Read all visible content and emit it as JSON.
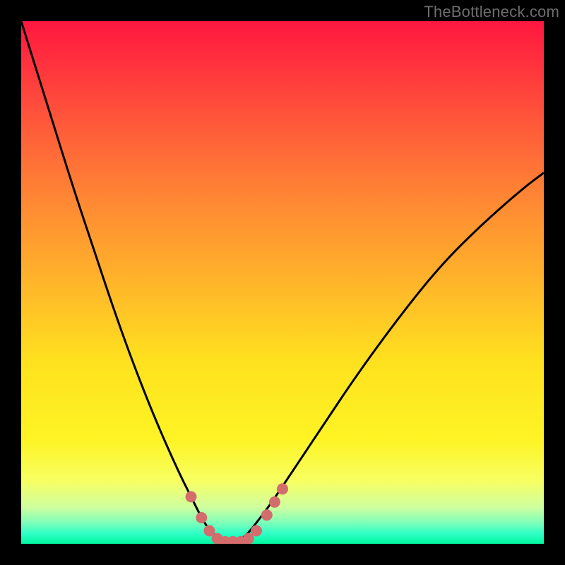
{
  "watermark": "TheBottleneck.com",
  "chart_data": {
    "type": "line",
    "title": "",
    "xlabel": "",
    "ylabel": "",
    "xlim": [
      0,
      100
    ],
    "ylim": [
      0,
      100
    ],
    "series": [
      {
        "name": "bottleneck-curve",
        "x": [
          0,
          5,
          10,
          14,
          18,
          22,
          26,
          30,
          33,
          35,
          37,
          39,
          41,
          43,
          45,
          48,
          52,
          58,
          64,
          72,
          80,
          88,
          96,
          100
        ],
        "y": [
          100,
          84,
          68,
          56,
          44,
          33,
          23,
          14,
          8,
          4,
          1.5,
          0.4,
          0.4,
          1.5,
          4,
          8,
          14,
          23,
          32,
          43,
          53,
          61,
          68,
          71
        ]
      }
    ],
    "markers": {
      "name": "highlight-dots",
      "color": "#d36d6d",
      "points": [
        {
          "x": 32.5,
          "y": 9.0
        },
        {
          "x": 34.5,
          "y": 5.0
        },
        {
          "x": 36.0,
          "y": 2.5
        },
        {
          "x": 37.5,
          "y": 1.0
        },
        {
          "x": 39.0,
          "y": 0.4
        },
        {
          "x": 40.5,
          "y": 0.4
        },
        {
          "x": 42.0,
          "y": 0.4
        },
        {
          "x": 43.5,
          "y": 1.0
        },
        {
          "x": 45.0,
          "y": 2.5
        },
        {
          "x": 47.0,
          "y": 5.5
        },
        {
          "x": 48.5,
          "y": 8.0
        },
        {
          "x": 50.0,
          "y": 10.5
        }
      ]
    },
    "gradient_stops": [
      {
        "pos": 0,
        "color": "#ff163f"
      },
      {
        "pos": 20,
        "color": "#ff5a3a"
      },
      {
        "pos": 50,
        "color": "#ffb52a"
      },
      {
        "pos": 80,
        "color": "#fef424"
      },
      {
        "pos": 96,
        "color": "#7dffb9"
      },
      {
        "pos": 100,
        "color": "#00f8a0"
      }
    ]
  }
}
